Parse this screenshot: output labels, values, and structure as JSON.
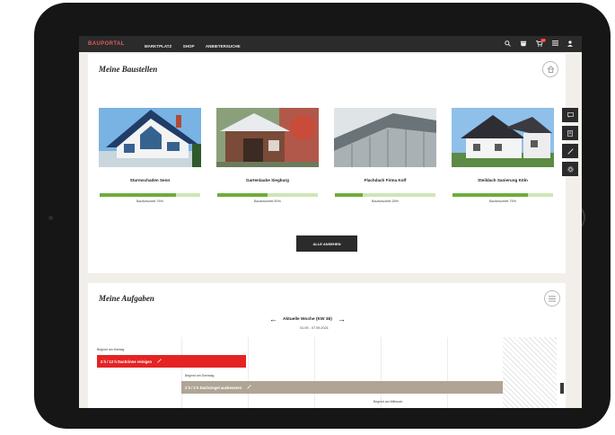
{
  "header": {
    "logo": "BAUPORTAL",
    "nav": [
      "MARKTPLATZ",
      "SHOP",
      "ANBIETERSUCHE"
    ],
    "cart_badge": "12"
  },
  "baustellen": {
    "title": "Meine Baustellen",
    "projects": [
      {
        "name": "Sturmschaden Senn",
        "progress": 0.76,
        "caption": "Bauforschritt 76%"
      },
      {
        "name": "Gartenlaube Siegburg",
        "progress": 0.5,
        "caption": "Bauforschritt 50%"
      },
      {
        "name": "Flachdach Firma Kolf",
        "progress": 0.28,
        "caption": "Bauforschritt 28%"
      },
      {
        "name": "Steildach Sanierung Köln",
        "progress": 0.75,
        "caption": "Bauforschritt 75%"
      }
    ],
    "all_button": "ALLE ANSEHEN"
  },
  "aufgaben": {
    "title": "Meine Aufgaben",
    "week": "Aktuelle Woche (KW 36)",
    "dates": "01.09 - 07.09.2021",
    "tasks": [
      {
        "label": "Beginnt am Montag",
        "text": "2 h / 12 h   Dachrinne reinigen"
      },
      {
        "label": "Beginnt am Dienstag",
        "text": "2 h / 2 h   Dachziegel ausbessern"
      },
      {
        "label": "Beginnt am Mittwoch",
        "text": ""
      }
    ]
  }
}
